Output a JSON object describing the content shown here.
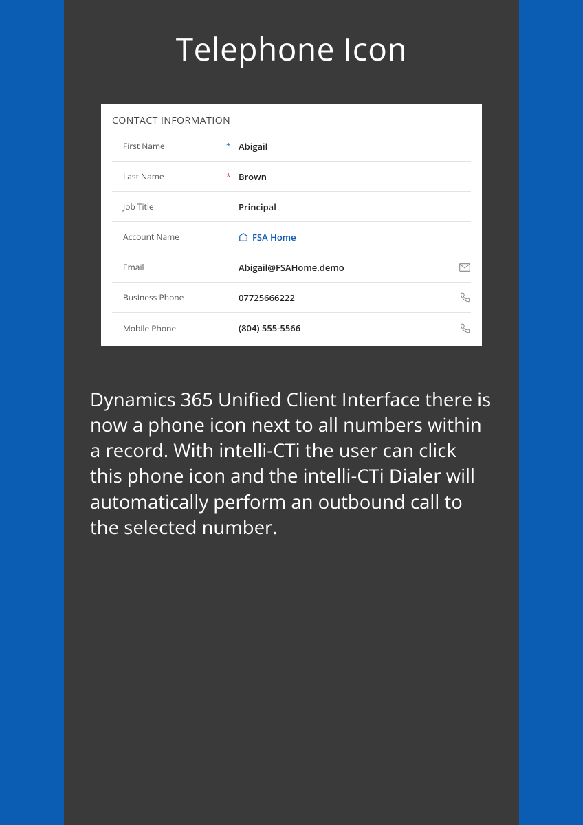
{
  "title": "Telephone Icon",
  "form": {
    "header": "CONTACT INFORMATION",
    "rows": {
      "first_name": {
        "label": "First Name",
        "value": "Abigail"
      },
      "last_name": {
        "label": "Last Name",
        "value": "Brown"
      },
      "job_title": {
        "label": "Job Title",
        "value": "Principal"
      },
      "account_name": {
        "label": "Account Name",
        "value": "FSA Home"
      },
      "email": {
        "label": "Email",
        "value": "Abigail@FSAHome.demo"
      },
      "business_phone": {
        "label": "Business Phone",
        "value": "07725666222"
      },
      "mobile_phone": {
        "label": "Mobile Phone",
        "value": "(804) 555-5566"
      }
    }
  },
  "body": "Dynamics 365 Unified Client Interface there is now a phone icon next to all numbers within a record. With intelli-CTi the user can click this phone icon and the intelli-CTi Dialer will automatically perform an outbound call to the selected number."
}
